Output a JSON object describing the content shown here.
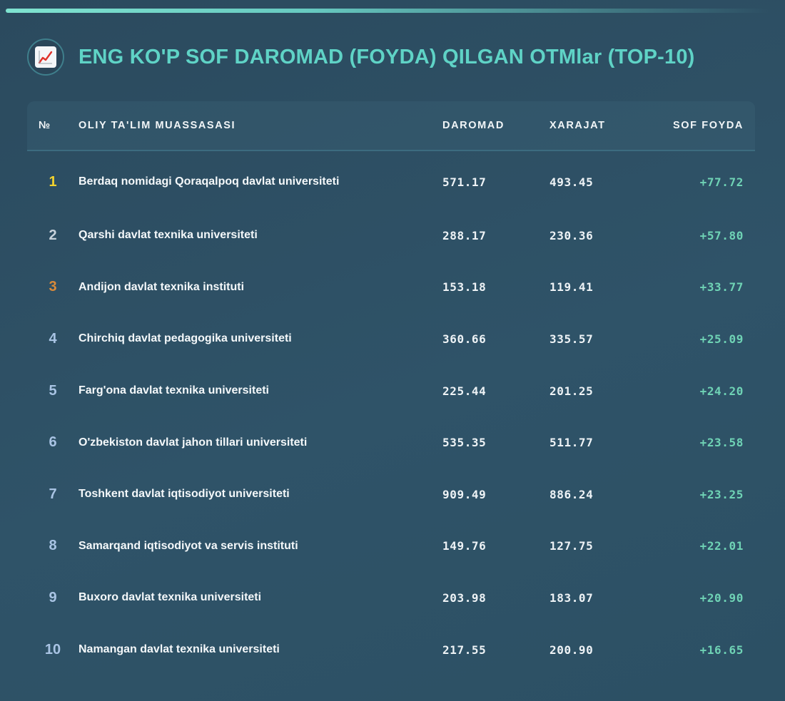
{
  "title": "ENG KO'P SOF DAROMAD (FOYDA) QILGAN OTMlar (TOP-10)",
  "title_icon": "chart-increasing-icon",
  "colors": {
    "accent": "#5fd3c6",
    "profit": "#6fd3b5",
    "rank_gold": "#f2d22e",
    "rank_silver": "#c9d3dc",
    "rank_bronze": "#d98a3a",
    "rank_default": "#a9c4e4"
  },
  "table": {
    "headers": {
      "num": "№",
      "name": "OLIY TA'LIM MUASSASASI",
      "income": "DAROMAD",
      "expense": "XARAJAT",
      "net": "SOF FOYDA"
    },
    "rows": [
      {
        "rank": "1",
        "name": "Berdaq nomidagi Qoraqalpoq davlat universiteti",
        "income": "571.17",
        "expense": "493.45",
        "net": "+77.72"
      },
      {
        "rank": "2",
        "name": "Qarshi davlat texnika universiteti",
        "income": "288.17",
        "expense": "230.36",
        "net": "+57.80"
      },
      {
        "rank": "3",
        "name": "Andijon davlat texnika instituti",
        "income": "153.18",
        "expense": "119.41",
        "net": "+33.77"
      },
      {
        "rank": "4",
        "name": "Chirchiq davlat pedagogika universiteti",
        "income": "360.66",
        "expense": "335.57",
        "net": "+25.09"
      },
      {
        "rank": "5",
        "name": "Farg'ona davlat texnika universiteti",
        "income": "225.44",
        "expense": "201.25",
        "net": "+24.20"
      },
      {
        "rank": "6",
        "name": "O'zbekiston davlat jahon tillari universiteti",
        "income": "535.35",
        "expense": "511.77",
        "net": "+23.58"
      },
      {
        "rank": "7",
        "name": "Toshkent davlat iqtisodiyot universiteti",
        "income": "909.49",
        "expense": "886.24",
        "net": "+23.25"
      },
      {
        "rank": "8",
        "name": "Samarqand iqtisodiyot va servis instituti",
        "income": "149.76",
        "expense": "127.75",
        "net": "+22.01"
      },
      {
        "rank": "9",
        "name": "Buxoro davlat texnika universiteti",
        "income": "203.98",
        "expense": "183.07",
        "net": "+20.90"
      },
      {
        "rank": "10",
        "name": "Namangan davlat texnika universiteti",
        "income": "217.55",
        "expense": "200.90",
        "net": "+16.65"
      }
    ]
  }
}
